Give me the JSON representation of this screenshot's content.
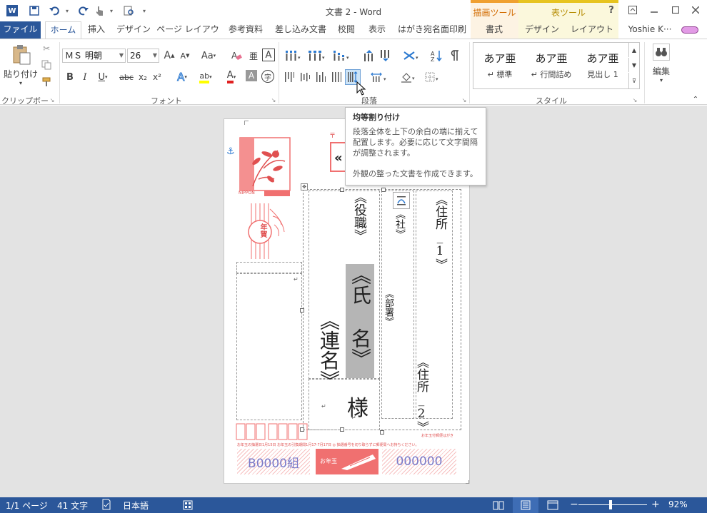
{
  "window": {
    "title": "文書 2 - Word"
  },
  "quick_access": {
    "undo_icon": "undo-icon",
    "redo_icon": "redo-icon"
  },
  "contextual": {
    "draw_tools": "描画ツール",
    "table_tools": "表ツール"
  },
  "window_controls": {
    "help": "?",
    "ribbon_display": "⊡",
    "minimize": "—",
    "maximize": "☐",
    "close": "✕"
  },
  "tabs": {
    "file": "ファイル",
    "home": "ホーム",
    "insert": "挿入",
    "design": "デザイン",
    "layout": "ページ レイアウト",
    "references": "参考資料",
    "mailings": "差し込み文書",
    "review": "校閲",
    "view": "表示",
    "postcard": "はがき宛名面印刷",
    "format": "書式",
    "table_design": "デザイン",
    "table_layout": "レイアウト",
    "user": "Yoshie K···"
  },
  "ribbon": {
    "clipboard": {
      "paste": "貼り付け",
      "label": "クリップボード"
    },
    "font": {
      "name": "ＭＳ 明朝",
      "size": "26",
      "label": "フォント",
      "bold": "B",
      "italic": "I",
      "underline": "U",
      "strike": "abc",
      "sub": "x₂",
      "sup": "x²",
      "grow": "A",
      "shrink": "A",
      "case": "Aa",
      "clear": "A",
      "charborder": "A",
      "effects": "A",
      "highlight": "ab",
      "fontcolor": "A",
      "shade": "A",
      "enclose": "字"
    },
    "paragraph": {
      "label": "段落"
    },
    "styles": {
      "label": "スタイル",
      "items": [
        {
          "preview": "あア亜",
          "name": "↵ 標準"
        },
        {
          "preview": "あア亜",
          "name": "↵ 行間詰め"
        },
        {
          "preview": "あア亜",
          "name": "見出し 1"
        }
      ]
    },
    "editing": {
      "label": "編集"
    }
  },
  "tooltip": {
    "title": "均等割り付け",
    "body": "段落全体を上下の余白の端に揃えて配置します。必要に応じて文字間隔が調整されます。",
    "footer": "外観の整った文書を作成できます。"
  },
  "document": {
    "postal_mark": "〒",
    "merge_top": "«",
    "yakushoku": "《役職》",
    "shamei": "《社》",
    "jusho1": "《住所_1》",
    "busho": "《部署》",
    "shimei": "《氏 名》",
    "renmei": "《連名》",
    "sama": "様",
    "jusho2": "《住所_2》",
    "nippon": "NIPPON",
    "nengajo": "年賀",
    "lottery_note": "お年玉付郵便はがき",
    "notice": "お年玉の抽選日1月15日 お年玉の引換期間1月17-7月17日 ◎ 抽選番号を切り取らずに郵便局へお持ちください。",
    "kumi": "B0000組",
    "number": "000000",
    "otoshidama": "お年玉",
    "ret_mark": "↵"
  },
  "status": {
    "page": "1/1 ページ",
    "words": "41 文字",
    "language": "日本語",
    "zoom": "92%",
    "zoom_minus": "−",
    "zoom_plus": "+"
  }
}
